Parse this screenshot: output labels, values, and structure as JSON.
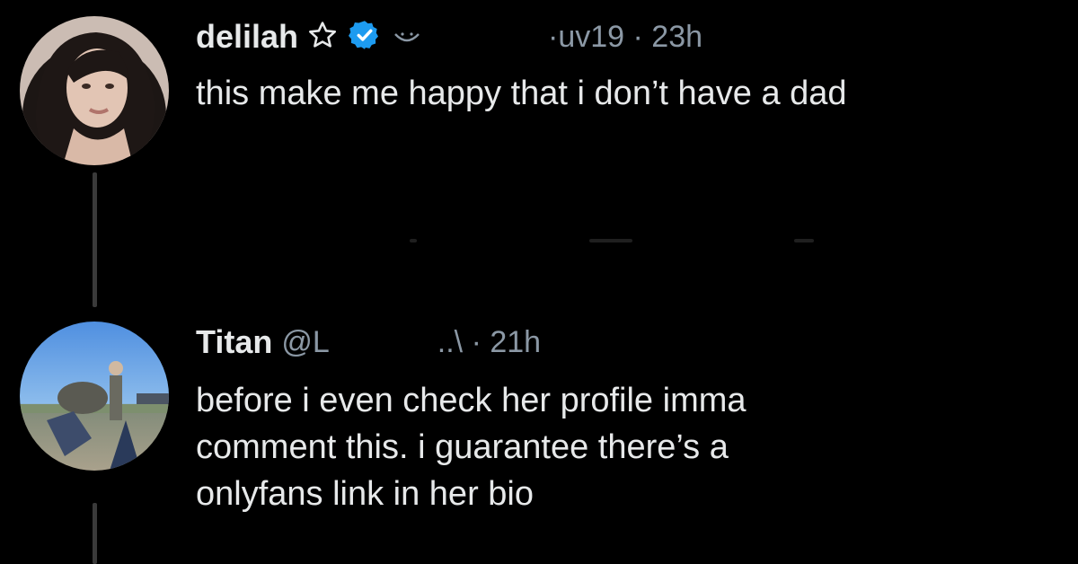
{
  "tweet1": {
    "name": "delilah",
    "handle_fragment": "·uv19 · 23h",
    "text": "this make me happy that i don’t have a dad",
    "icons": [
      "star-icon",
      "verified-badge-icon",
      "smile-emoji-icon"
    ],
    "verified_color": "#1d9bf0"
  },
  "tweet2": {
    "name": "Titan",
    "handle": "@L",
    "meta": "..\\ · 21h",
    "text_lines": [
      "before i even check her profile imma",
      "comment this. i guarantee there’s a",
      "onlyfans link in her bio"
    ]
  },
  "colors": {
    "background": "#000000",
    "primary_text": "#e7e9ea",
    "secondary_text": "#8b98a5",
    "thread_line": "#3a3a3a"
  }
}
